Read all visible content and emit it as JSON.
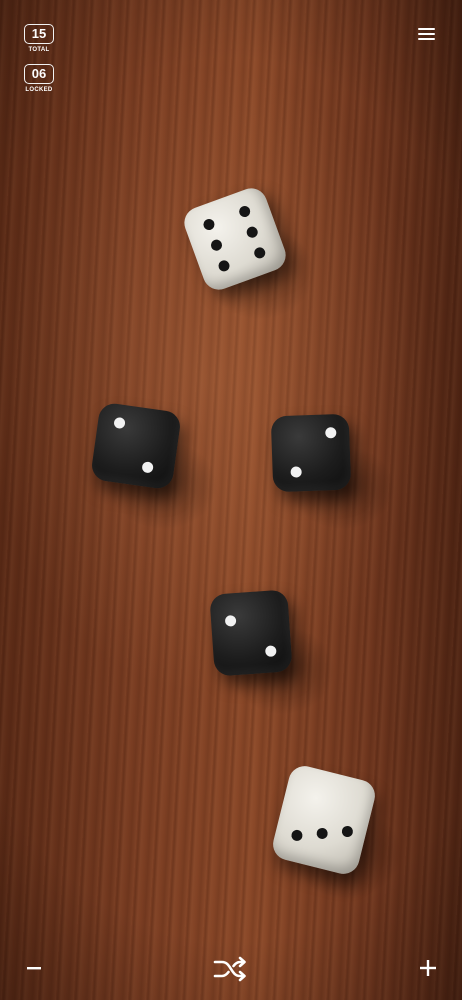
{
  "stats": {
    "total_value": "15",
    "total_label": "TOTAL",
    "locked_value": "06",
    "locked_label": "LOCKED"
  },
  "icons": {
    "menu": "hamburger-menu-icon",
    "decrement": "minus-icon",
    "shuffle": "shuffle-icon",
    "increment": "plus-icon"
  },
  "dice": [
    {
      "id": "die-1",
      "value": 6,
      "color": "white"
    },
    {
      "id": "die-2",
      "value": 2,
      "color": "black"
    },
    {
      "id": "die-3",
      "value": 2,
      "color": "black"
    },
    {
      "id": "die-4",
      "value": 2,
      "color": "black"
    },
    {
      "id": "die-5",
      "value": 3,
      "color": "white"
    }
  ],
  "colors": {
    "table_wood": "#7a3d22",
    "die_white": "#dedbd2",
    "die_black": "#1d1d1d",
    "ui_text": "#ffffff"
  }
}
